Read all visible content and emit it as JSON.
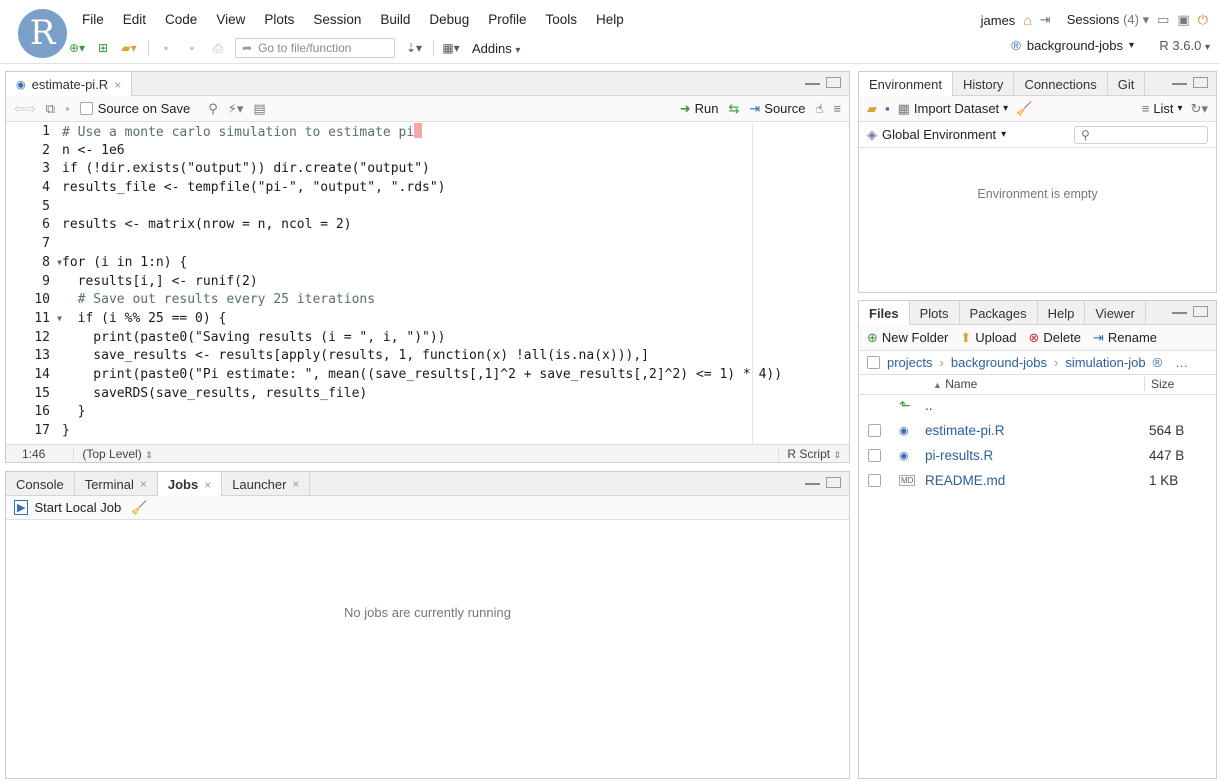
{
  "menubar": {
    "items": [
      "File",
      "Edit",
      "Code",
      "View",
      "Plots",
      "Session",
      "Build",
      "Debug",
      "Profile",
      "Tools",
      "Help"
    ],
    "user": "james",
    "sessions_label": "Sessions",
    "sessions_count": "(4)",
    "goto_placeholder": "Go to file/function",
    "addins_label": "Addins",
    "project_name": "background-jobs",
    "r_version": "R 3.6.0"
  },
  "source": {
    "file_tab": "estimate-pi.R",
    "source_on_save": "Source on Save",
    "run_label": "Run",
    "source_label": "Source",
    "lines": [
      "# Use a monte carlo simulation to estimate pi",
      "n <- 1e6",
      "if (!dir.exists(\"output\")) dir.create(\"output\")",
      "results_file <- tempfile(\"pi-\", \"output\", \".rds\")",
      "",
      "results <- matrix(nrow = n, ncol = 2)",
      "",
      "for (i in 1:n) {",
      "  results[i,] <- runif(2)",
      "  # Save out results every 25 iterations",
      "  if (i %% 25 == 0) {",
      "    print(paste0(\"Saving results (i = \", i, \")\"))",
      "    save_results <- results[apply(results, 1, function(x) !all(is.na(x))),]",
      "    print(paste0(\"Pi estimate: \", mean((save_results[,1]^2 + save_results[,2]^2) <= 1) * 4))",
      "    saveRDS(save_results, results_file)",
      "  }",
      "}"
    ],
    "line_numbers": [
      "1",
      "2",
      "3",
      "4",
      "5",
      "6",
      "7",
      "8",
      "9",
      "10",
      "11",
      "12",
      "13",
      "14",
      "15",
      "16",
      "17"
    ],
    "cursor_pos": "1:46",
    "scope": "(Top Level)",
    "file_type": "R Script"
  },
  "bottom_left": {
    "tabs": [
      "Console",
      "Terminal",
      "Jobs",
      "Launcher"
    ],
    "active_tab": "Jobs",
    "start_job": "Start Local Job",
    "empty_message": "No jobs are currently running"
  },
  "environment": {
    "tabs": [
      "Environment",
      "History",
      "Connections",
      "Git"
    ],
    "import_dataset": "Import Dataset",
    "view_mode": "List",
    "scope": "Global Environment",
    "empty_message": "Environment is empty"
  },
  "files": {
    "tabs": [
      "Files",
      "Plots",
      "Packages",
      "Help",
      "Viewer"
    ],
    "new_folder": "New Folder",
    "upload": "Upload",
    "delete": "Delete",
    "rename": "Rename",
    "breadcrumb": [
      "projects",
      "background-jobs",
      "simulation-job"
    ],
    "col_name": "Name",
    "col_size": "Size",
    "parent": "..",
    "rows": [
      {
        "name": "estimate-pi.R",
        "size": "564 B"
      },
      {
        "name": "pi-results.R",
        "size": "447 B"
      },
      {
        "name": "README.md",
        "size": "1 KB"
      }
    ]
  }
}
